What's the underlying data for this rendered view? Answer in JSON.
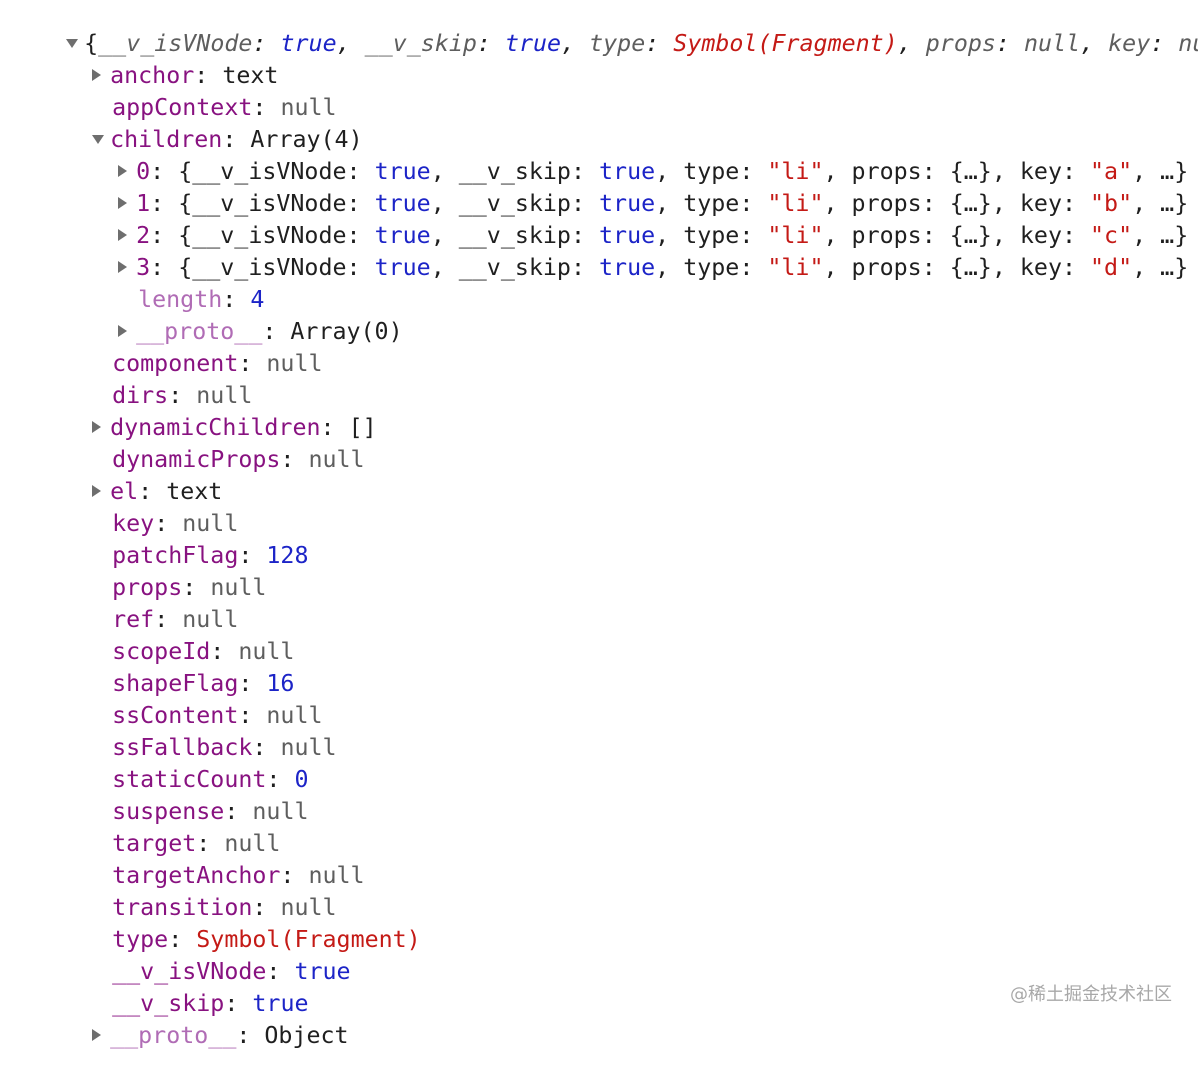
{
  "header": {
    "prefix": "{",
    "k1": "__v_isVNode",
    "v1": "true",
    "k2": "__v_skip",
    "v2": "true",
    "k3": "type",
    "v3": "Symbol(Fragment)",
    "k4": "props",
    "v4": "null",
    "k5": "key",
    "v5": "nul"
  },
  "rows": {
    "anchor": {
      "key": "anchor",
      "value": "text"
    },
    "appContext": {
      "key": "appContext",
      "value": "null"
    },
    "children": {
      "key": "children",
      "value": "Array(4)"
    },
    "child0": {
      "index": "0",
      "type": "\"li\"",
      "key": "\"a\""
    },
    "child1": {
      "index": "1",
      "type": "\"li\"",
      "key": "\"b\""
    },
    "child2": {
      "index": "2",
      "type": "\"li\"",
      "key": "\"c\""
    },
    "child3": {
      "index": "3",
      "type": "\"li\"",
      "key": "\"d\""
    },
    "child_common": {
      "isVNode": "__v_isVNode",
      "true1": "true",
      "skip": "__v_skip",
      "true2": "true",
      "typeKey": "type",
      "propsKey": "props",
      "propsVal": "{…}",
      "keyKey": "key",
      "ellipsis": "…}"
    },
    "length": {
      "key": "length",
      "value": "4"
    },
    "childrenProto": {
      "key": "__proto__",
      "value": "Array(0)"
    },
    "component": {
      "key": "component",
      "value": "null"
    },
    "dirs": {
      "key": "dirs",
      "value": "null"
    },
    "dynamicChildren": {
      "key": "dynamicChildren",
      "value": "[]"
    },
    "dynamicProps": {
      "key": "dynamicProps",
      "value": "null"
    },
    "el": {
      "key": "el",
      "value": "text"
    },
    "key": {
      "key": "key",
      "value": "null"
    },
    "patchFlag": {
      "key": "patchFlag",
      "value": "128"
    },
    "props": {
      "key": "props",
      "value": "null"
    },
    "ref": {
      "key": "ref",
      "value": "null"
    },
    "scopeId": {
      "key": "scopeId",
      "value": "null"
    },
    "shapeFlag": {
      "key": "shapeFlag",
      "value": "16"
    },
    "ssContent": {
      "key": "ssContent",
      "value": "null"
    },
    "ssFallback": {
      "key": "ssFallback",
      "value": "null"
    },
    "staticCount": {
      "key": "staticCount",
      "value": "0"
    },
    "suspense": {
      "key": "suspense",
      "value": "null"
    },
    "target": {
      "key": "target",
      "value": "null"
    },
    "targetAnchor": {
      "key": "targetAnchor",
      "value": "null"
    },
    "transition": {
      "key": "transition",
      "value": "null"
    },
    "type": {
      "key": "type",
      "value": "Symbol(Fragment)"
    },
    "isVNode": {
      "key": "__v_isVNode",
      "value": "true"
    },
    "skip": {
      "key": "__v_skip",
      "value": "true"
    },
    "proto": {
      "key": "__proto__",
      "value": "Object"
    }
  },
  "watermark": "@稀土掘金技术社区",
  "colors": {
    "key": "#881280",
    "number": "#1c24c7",
    "string": "#c41a16",
    "null": "#5e5e5e"
  }
}
